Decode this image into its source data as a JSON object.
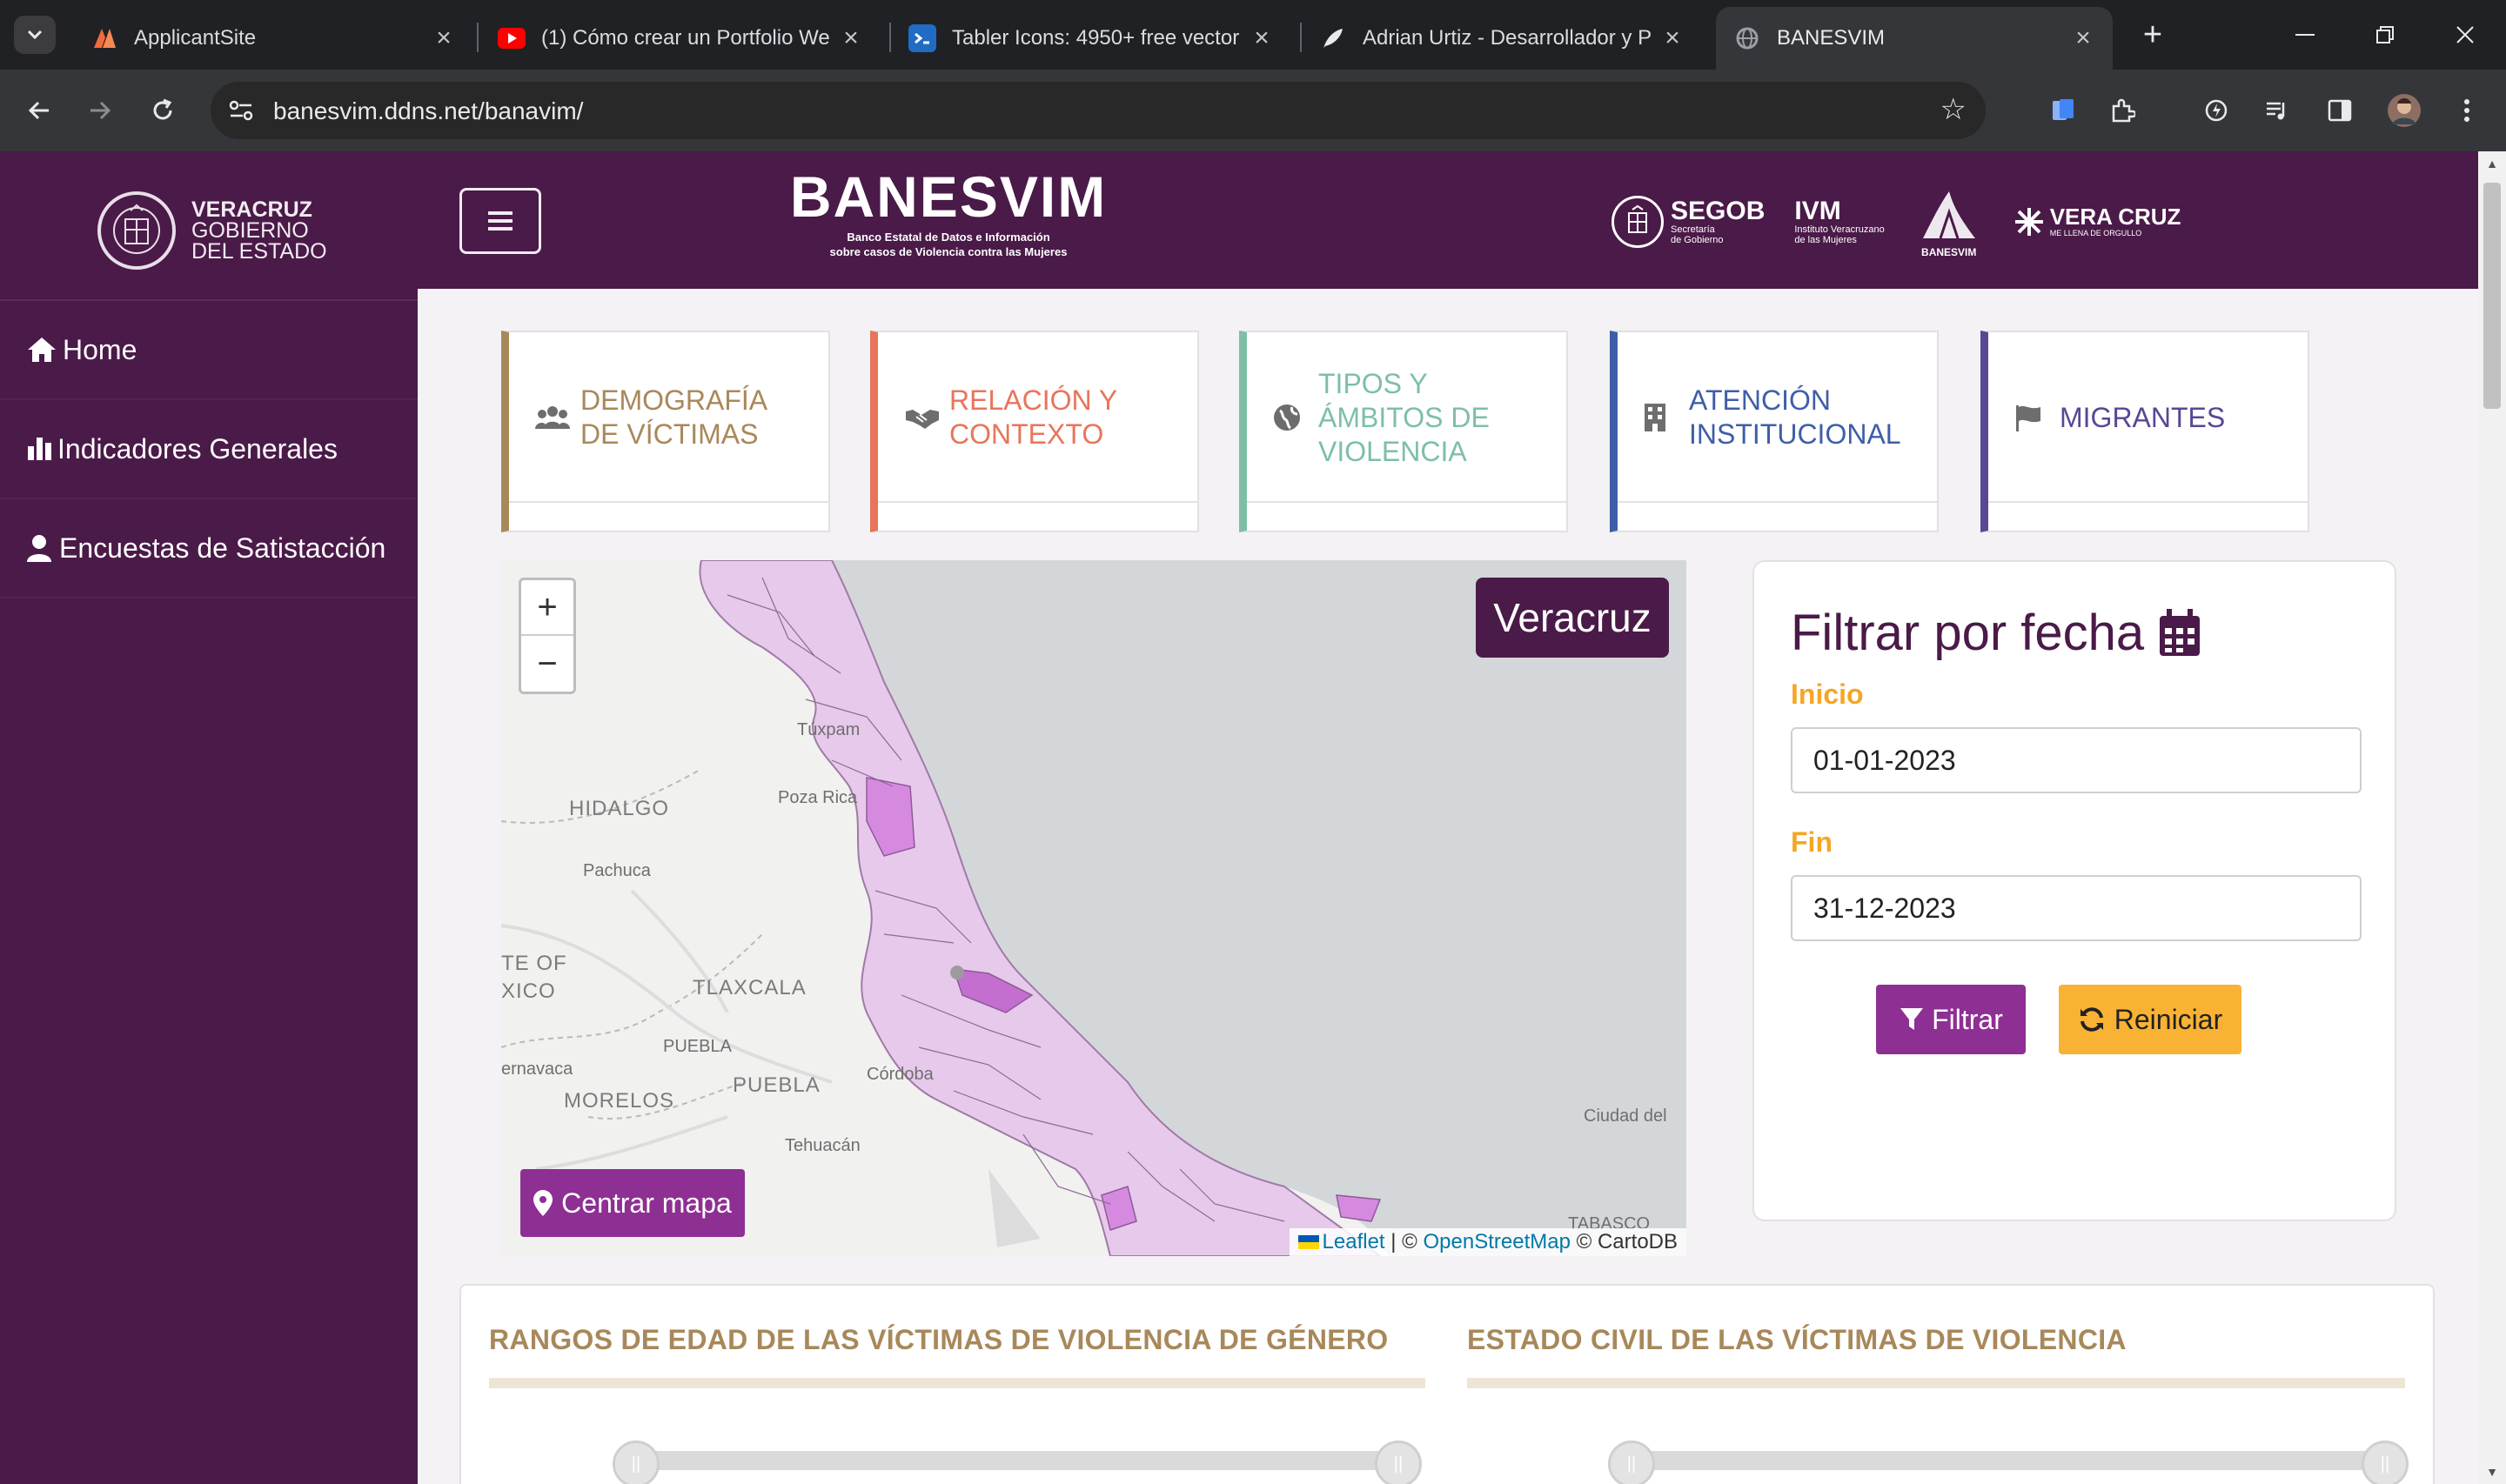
{
  "browser": {
    "tabs": [
      {
        "title": "ApplicantSite",
        "favicon": "applicantsite-icon",
        "color": "#f26b3a"
      },
      {
        "title": "(1) Cómo crear un Portfolio We",
        "favicon": "youtube-icon",
        "color": "#ff0000"
      },
      {
        "title": "Tabler Icons: 4950+ free vector",
        "favicon": "tabler-icon",
        "color": "#206bc4"
      },
      {
        "title": "Adrian Urtiz - Desarrollador y P",
        "favicon": "feather-icon",
        "color": "#e8eaed"
      },
      {
        "title": "BANESVIM",
        "favicon": "globe-icon",
        "color": "#9aa0a6"
      }
    ],
    "url": "banesvim.ddns.net/banavim/"
  },
  "header": {
    "brand_line1": "VERACRUZ",
    "brand_line2": "GOBIERNO",
    "brand_line3": "DEL ESTADO",
    "logo_title": "BANESVIM",
    "logo_sub1": "Banco Estatal de Datos e Información",
    "logo_sub2": "sobre casos de Violencia contra las Mujeres",
    "partners": [
      {
        "name": "SEGOB",
        "sub1": "Secretaría",
        "sub2": "de Gobierno"
      },
      {
        "name": "IVM",
        "sub1": "Instituto Veracruzano",
        "sub2": "de las Mujeres"
      },
      {
        "name": "BANESVIM",
        "sub1": "",
        "sub2": ""
      },
      {
        "name": "VERA CRUZ",
        "sub1": "ME LLENA DE ORGULLO",
        "sub2": ""
      }
    ]
  },
  "sidebar": {
    "items": [
      {
        "label": "Home",
        "icon": "home-icon"
      },
      {
        "label": "Indicadores Generales",
        "icon": "bar-chart-icon"
      },
      {
        "label": "Encuestas de Satistacción",
        "icon": "user-icon"
      }
    ]
  },
  "cards": [
    {
      "label_line1": "DEMOGRAFÍA",
      "label_line2": "DE VÍCTIMAS",
      "label_line3": "",
      "icon": "users-icon",
      "color": "#a8885a"
    },
    {
      "label_line1": "RELACIÓN Y",
      "label_line2": "CONTEXTO",
      "label_line3": "",
      "icon": "handshake-icon",
      "color": "#e8755a"
    },
    {
      "label_line1": "TIPOS Y",
      "label_line2": "ÁMBITOS DE",
      "label_line3": "VIOLENCIA",
      "icon": "globe-icon",
      "color": "#7dbfa6"
    },
    {
      "label_line1": "ATENCIÓN",
      "label_line2": "INSTITUCIONAL",
      "label_line3": "",
      "icon": "building-icon",
      "color": "#3f5ea8"
    },
    {
      "label_line1": "MIGRANTES",
      "label_line2": "",
      "label_line3": "",
      "icon": "flag-icon",
      "color": "#5a4694"
    }
  ],
  "map": {
    "zoom_in": "+",
    "zoom_out": "−",
    "region_label": "Veracruz",
    "center_button": "Centrar mapa",
    "attribution_leaflet": "Leaflet",
    "attribution_sep": " | © ",
    "attribution_osm": "OpenStreetMap",
    "attribution_carto": " © CartoDB",
    "labels": {
      "hidalgo": "HIDALGO",
      "pachuca": "Pachuca",
      "tlaxcala_title": "TLAXCALA",
      "puebla_city": "PUEBLA",
      "puebla_state": "PUEBLA",
      "morelos": "MORELOS",
      "cuernavaca": "ernavaca",
      "tehuacan": "Tehuacán",
      "tuxpam": "Túxpam",
      "poza_rica": "Poza Rica",
      "edo_mex_1": "TE OF",
      "edo_mex_2": "XICO",
      "ciudad_del": "Ciudad del",
      "tabasco": "TABASCO",
      "cordoba": "Córdoba"
    }
  },
  "filter": {
    "title": "Filtrar por fecha",
    "start_label": "Inicio",
    "start_value": "01-01-2023",
    "end_label": "Fin",
    "end_value": "31-12-2023",
    "filter_button": "Filtrar",
    "reset_button": "Reiniciar"
  },
  "charts": {
    "left_title": "RANGOS DE EDAD DE LAS VÍCTIMAS DE VIOLENCIA DE GÉNERO",
    "right_title": "ESTADO CIVIL DE LAS VÍCTIMAS DE VIOLENCIA"
  },
  "colors": {
    "primary_purple": "#4a1a48",
    "button_purple": "#8e2f93",
    "accent_orange": "#f9b233",
    "label_orange": "#f5a623"
  }
}
